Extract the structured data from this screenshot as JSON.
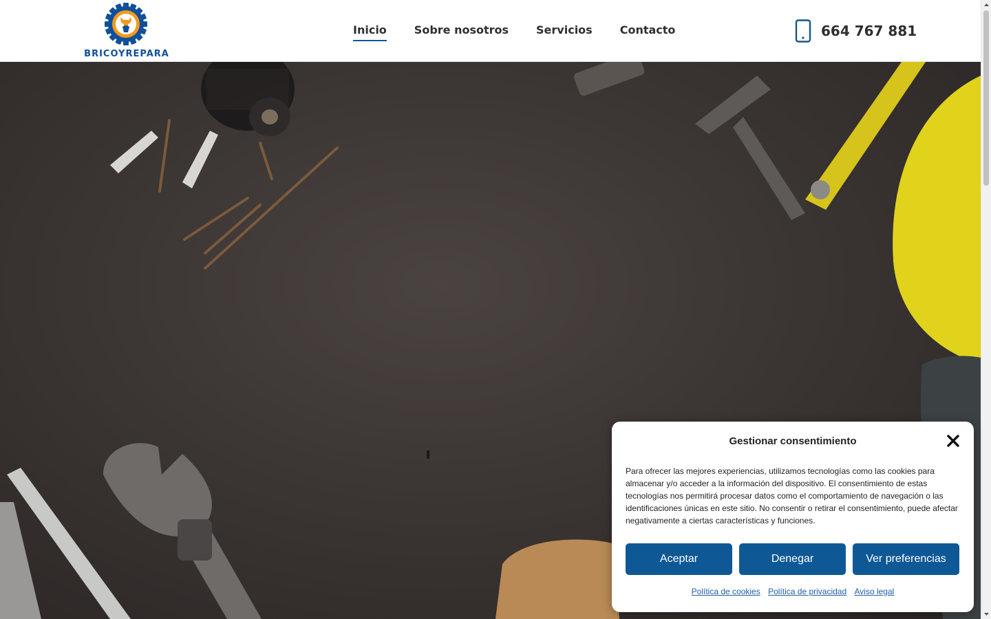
{
  "brand": {
    "name": "BRICOYREPARA",
    "colors": {
      "blue": "#10509a",
      "orange": "#f29a1f",
      "button": "#0f5896"
    }
  },
  "nav": {
    "items": [
      {
        "label": "Inicio",
        "active": true
      },
      {
        "label": "Sobre nosotros",
        "active": false
      },
      {
        "label": "Servicios",
        "active": false
      },
      {
        "label": "Contacto",
        "active": false
      }
    ]
  },
  "phone": {
    "icon": "smartphone-icon",
    "number": "664 767 881"
  },
  "cookie": {
    "title": "Gestionar consentimiento",
    "close_icon": "close-icon",
    "body": "Para ofrecer las mejores experiencias, utilizamos tecnologías como las cookies para almacenar y/o acceder a la información del dispositivo. El consentimiento de estas tecnologías nos permitirá procesar datos como el comportamiento de navegación o las identificaciones únicas en este sitio. No consentir o retirar el consentimiento, puede afectar negativamente a ciertas características y funciones.",
    "buttons": {
      "accept": "Aceptar",
      "deny": "Denegar",
      "preferences": "Ver preferencias"
    },
    "links": {
      "cookies": "Política de cookies",
      "privacy": "Política de privacidad",
      "legal": "Aviso legal"
    }
  }
}
